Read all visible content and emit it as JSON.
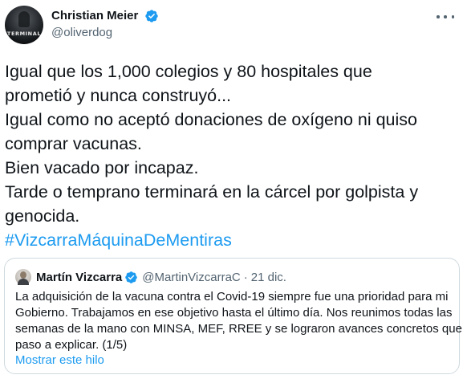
{
  "author": {
    "display_name": "Christian Meier",
    "handle": "@oliverdog",
    "avatar_label": "TERMINAL"
  },
  "tweet": {
    "lines": [
      "Igual que los 1,000 colegios y 80 hospitales que",
      "prometió y nunca construyó...",
      "Igual como no aceptó donaciones de oxígeno ni quiso",
      "comprar vacunas.",
      "Bien vacado por incapaz.",
      "Tarde o temprano terminará en la cárcel por golpista y",
      "genocida."
    ],
    "hashtag": "#VizcarraMáquinaDeMentiras"
  },
  "quoted": {
    "display_name": "Martín Vizcarra",
    "handle": "@MartinVizcarraC",
    "separator": "·",
    "date": "21 dic.",
    "lines": [
      "La adquisición de la vacuna contra el Covid-19 siempre fue una prioridad para mi",
      "Gobierno. Trabajamos en ese objetivo hasta el último día. Nos reunimos todas las",
      "semanas de la mano con MINSA, MEF, RREE y se lograron avances concretos que",
      "paso a explicar. (1/5)"
    ],
    "show_thread": "Mostrar este hilo"
  },
  "icons": {
    "verified": "verified-badge-icon",
    "more": "more-options-icon"
  },
  "colors": {
    "link": "#1d9bf0",
    "text": "#0f1419",
    "secondary": "#536471",
    "border": "#cfd9de"
  }
}
